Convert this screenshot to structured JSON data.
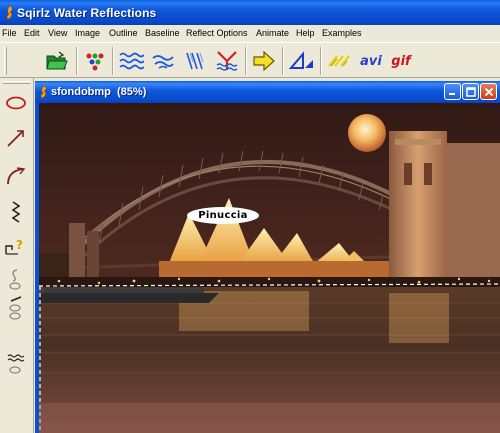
{
  "app": {
    "title": "Sqirlz Water Reflections",
    "icon": "squirrel-app-icon"
  },
  "menu": [
    {
      "label": "File"
    },
    {
      "label": "Edit"
    },
    {
      "label": "View"
    },
    {
      "label": "Image"
    },
    {
      "label": "Outline"
    },
    {
      "label": "Baseline"
    },
    {
      "label": "Reflect Options"
    },
    {
      "label": "Animate"
    },
    {
      "label": "Help"
    },
    {
      "label": "Examples"
    }
  ],
  "toolbar": {
    "buttons": [
      {
        "icon": "open-folder-icon"
      },
      {
        "icon": "color-dots-icon"
      },
      {
        "icon": "waves-icon"
      },
      {
        "icon": "ripples-icon"
      },
      {
        "icon": "rain-lines-icon"
      },
      {
        "icon": "reflection-y-icon"
      },
      {
        "icon": "arrow-right-icon"
      },
      {
        "icon": "perspective-triangle-icon"
      },
      {
        "icon": "sparkle-lines-icon"
      },
      {
        "label": "avi"
      },
      {
        "label": "gif"
      }
    ],
    "colors": {
      "avi": "#2a3fc6",
      "gif": "#d0161f",
      "arrow": "#f2e12a"
    }
  },
  "tools": [
    {
      "icon": "ellipse-tool-icon"
    },
    {
      "icon": "line-arrow-tool-icon"
    },
    {
      "icon": "curve-tool-icon"
    },
    {
      "icon": "zigzag-tool-icon"
    },
    {
      "icon": "baseline-question-icon"
    },
    {
      "icon": "hook-tool-icon"
    },
    {
      "icon": "pen-baseline-icon"
    },
    {
      "icon": "wave-baseline-icon"
    }
  ],
  "document": {
    "title": "sfondobmp",
    "zoom": "(85%)",
    "window_buttons": [
      "minimize",
      "maximize",
      "close"
    ],
    "label": "Pinuccia"
  }
}
